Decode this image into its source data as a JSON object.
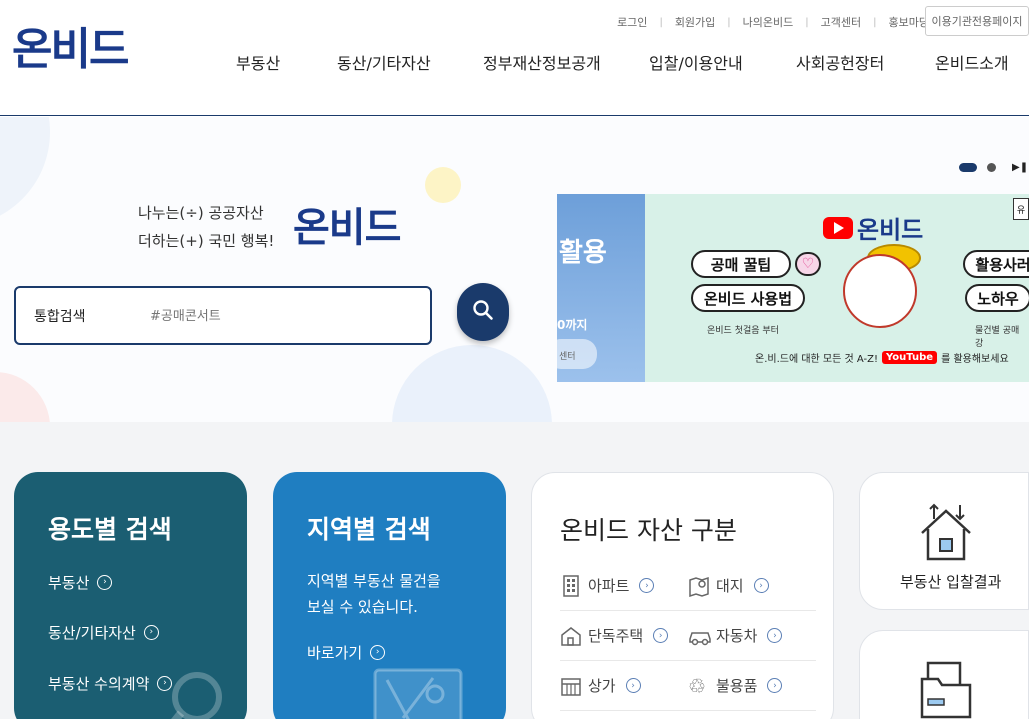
{
  "header": {
    "logo": "온비드",
    "util_links": [
      "로그인",
      "회원가입",
      "나의온비드",
      "고객센터",
      "홍보마당"
    ],
    "util_button": "이용기관전용페이지",
    "gnb": [
      "부동산",
      "동산/기타자산",
      "정부재산정보공개",
      "입찰/이용안내",
      "사회공헌장터",
      "온비드소개"
    ]
  },
  "hero": {
    "tagline_line1": "나누는(÷) 공공자산",
    "tagline_line2": "더하는(+) 국민 행복!",
    "logo": "온비드",
    "search_label": "통합검색",
    "search_placeholder": "#공매콘서트"
  },
  "banner": {
    "left_title": "활용",
    "left_sub": "0까지",
    "left_btn": "센터",
    "yt_brand": "온비드",
    "pill1": "공매 꿀팁",
    "pill2": "온비드 사용법",
    "pill3": "활용사러",
    "pill4": "노하우",
    "small1": "온비드 첫걸음 부터",
    "small2": "물건별 공매 강",
    "bottom_text1": "온.비.드에 대한 모든 것 A-Z!",
    "bottom_yt": "YouTube",
    "bottom_text2": "를 활용해보세요",
    "corner": "유"
  },
  "cards": {
    "purpose": {
      "title": "용도별 검색",
      "links": [
        "부동산",
        "동산/기타자산",
        "부동산 수의계약"
      ]
    },
    "region": {
      "title": "지역별 검색",
      "desc_line1": "지역별 부동산 물건을",
      "desc_line2": "보실 수 있습니다.",
      "link": "바로가기"
    },
    "asset": {
      "title": "온비드 자산 구분",
      "items": [
        "아파트",
        "대지",
        "단독주택",
        "자동차",
        "상가",
        "불용품"
      ]
    },
    "result": {
      "label": "부동산 입찰결과"
    }
  },
  "colors": {
    "brand_navy": "#1a3a6b",
    "purpose_card": "#1b5e72",
    "region_card": "#1f7ec1"
  }
}
